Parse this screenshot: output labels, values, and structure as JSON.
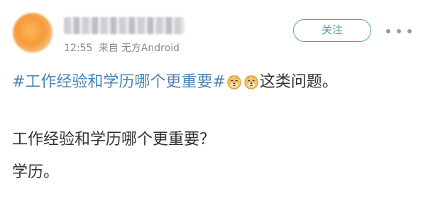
{
  "header": {
    "time": "12:55",
    "source_prefix": "来自",
    "source_device": "无方Android",
    "follow_label": "关注"
  },
  "content": {
    "topic": "#工作经验和学历哪个更重要#",
    "line1_suffix": "这类问题。",
    "line2": "工作经验和学历哪个更重要？",
    "line3": "学历。"
  },
  "icons": {
    "emoji": "doge-emoji-icon",
    "more": "more-dots-icon"
  },
  "colors": {
    "topic": "#4a84b4",
    "follow": "#4a9fa2"
  }
}
